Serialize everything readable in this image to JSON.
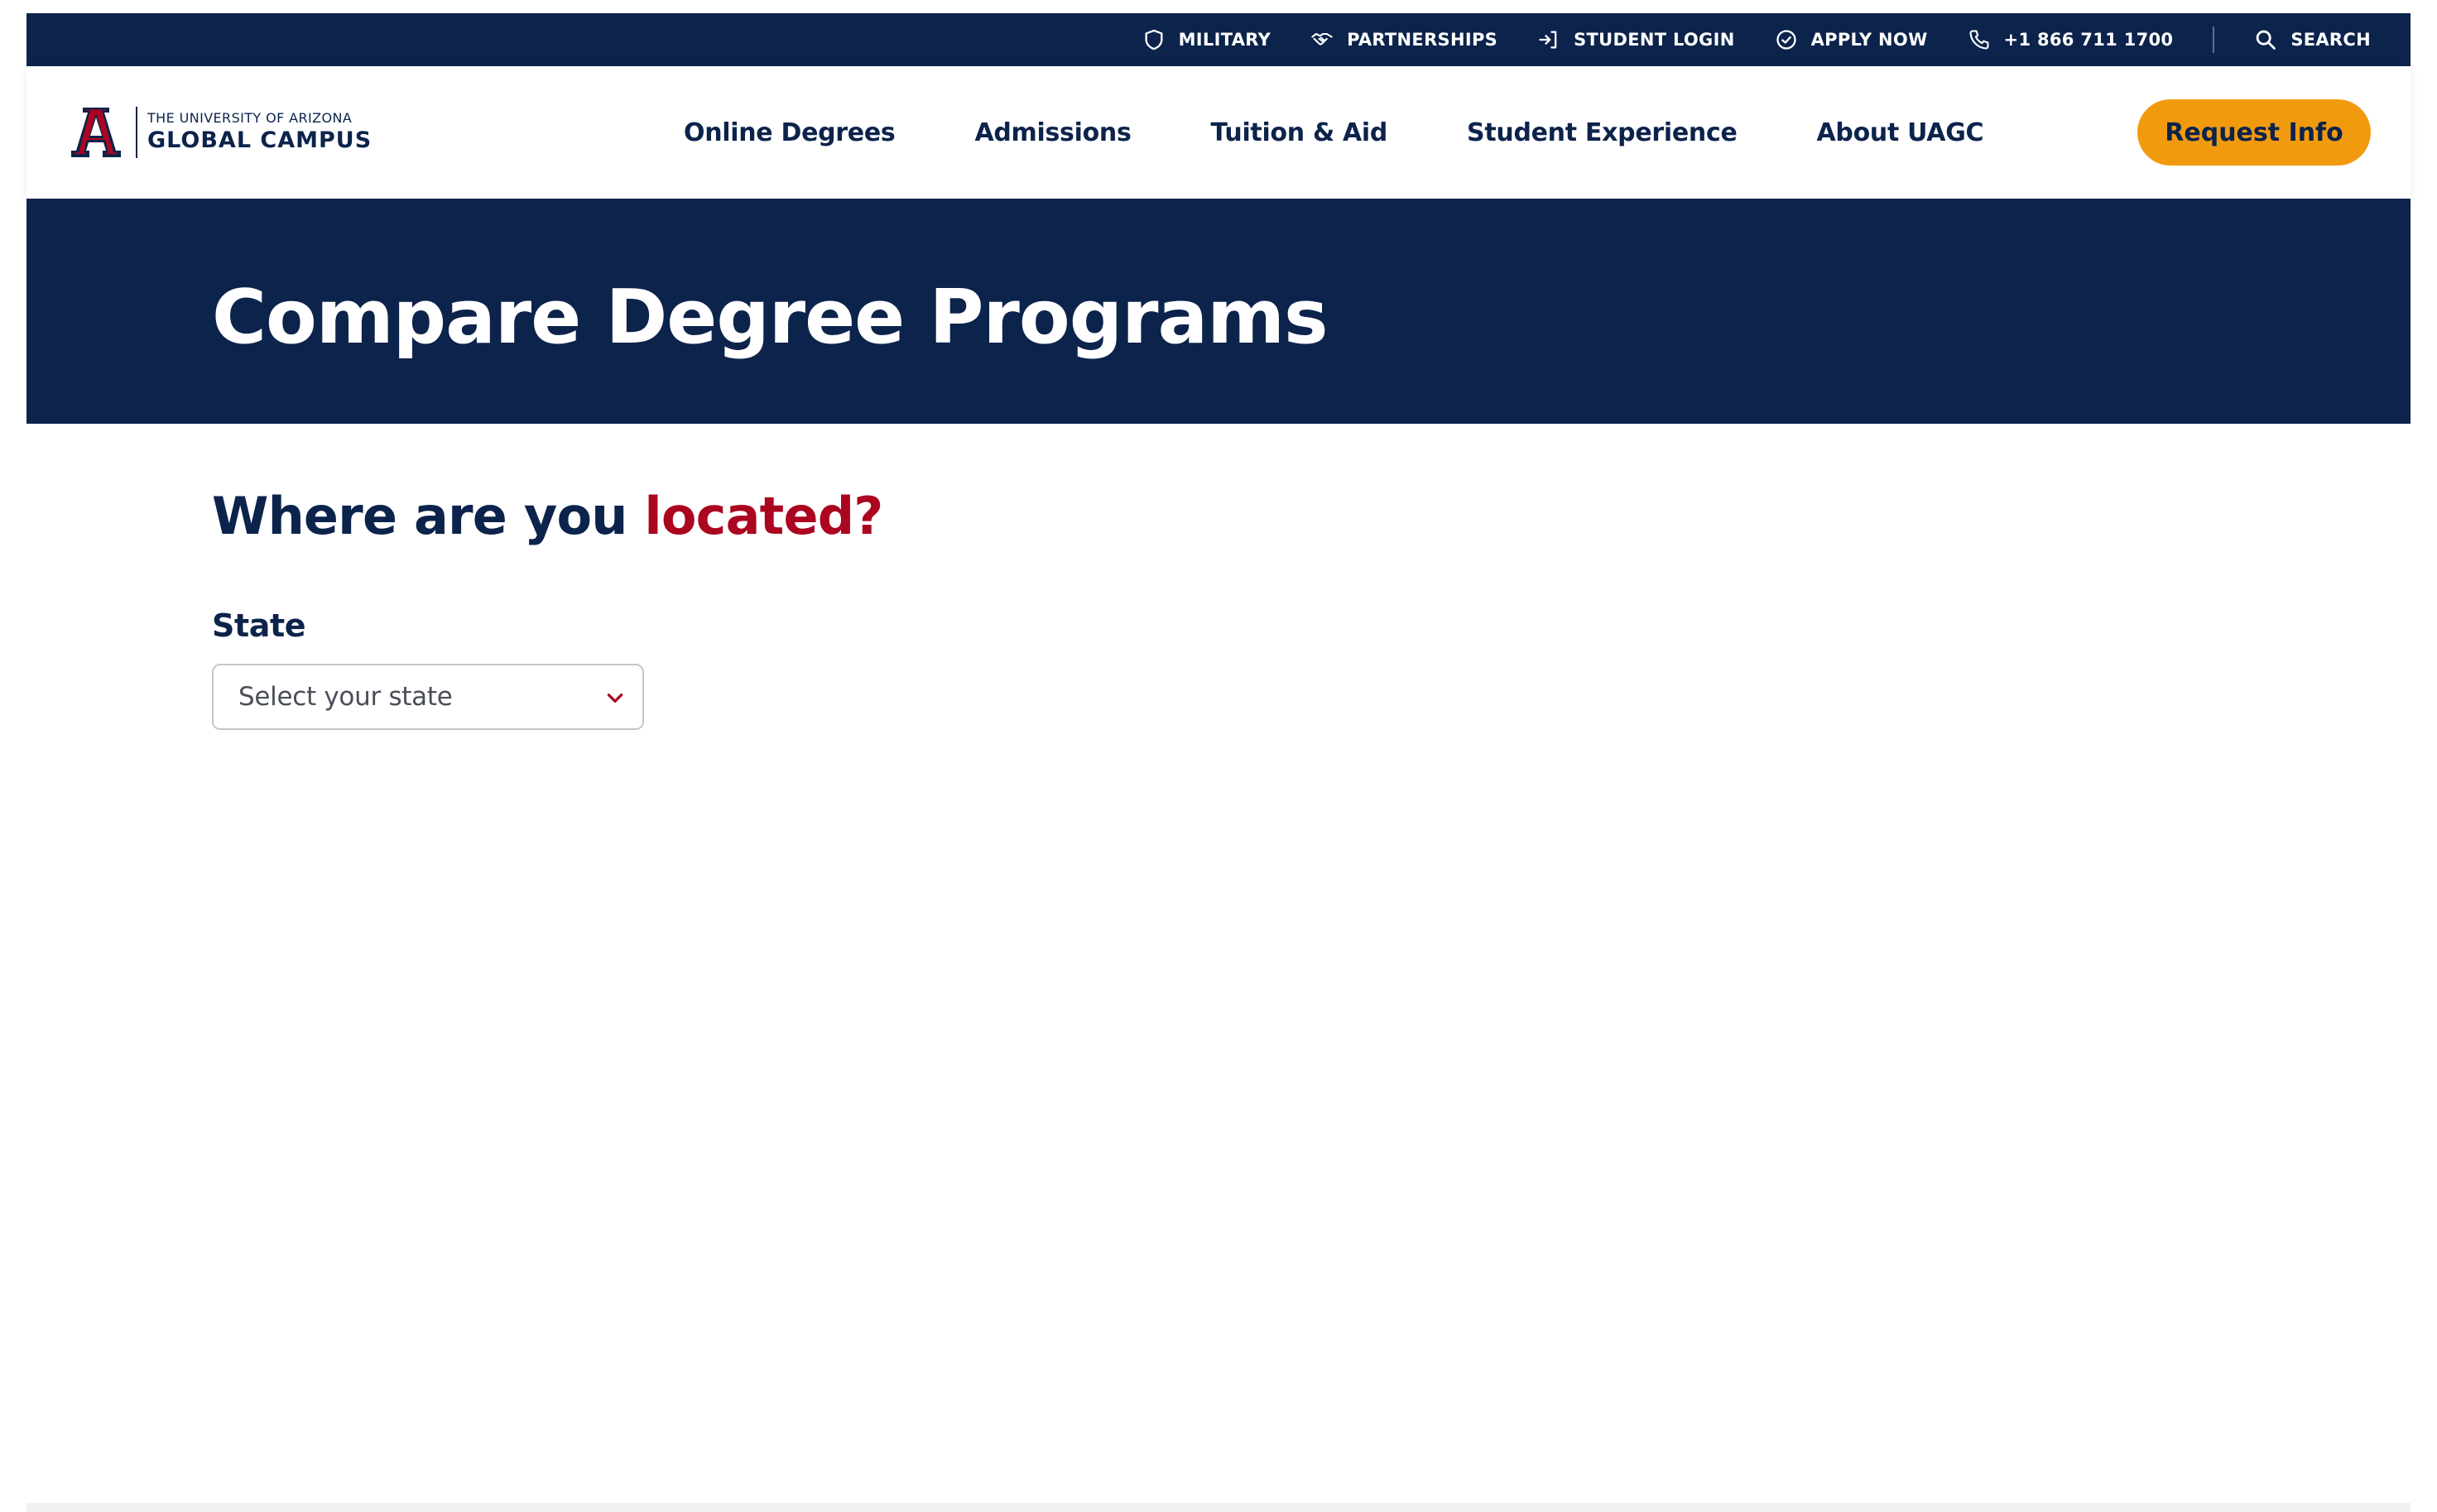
{
  "utility_bar": {
    "items": [
      {
        "label": "MILITARY",
        "icon": "shield-icon"
      },
      {
        "label": "PARTNERSHIPS",
        "icon": "handshake-icon"
      },
      {
        "label": "STUDENT LOGIN",
        "icon": "login-icon"
      },
      {
        "label": "APPLY NOW",
        "icon": "check-circle-icon"
      },
      {
        "label": "+1 866 711 1700",
        "icon": "phone-icon"
      }
    ],
    "search_label": "SEARCH",
    "search_icon": "search-icon"
  },
  "header": {
    "logo": {
      "line1": "THE UNIVERSITY OF ARIZONA",
      "line2": "GLOBAL CAMPUS"
    },
    "nav": [
      "Online Degrees",
      "Admissions",
      "Tuition & Aid",
      "Student Experience",
      "About UAGC"
    ],
    "cta_label": "Request Info"
  },
  "hero": {
    "title": "Compare Degree Programs"
  },
  "location": {
    "heading_main": "Where are you",
    "heading_accent": "located?",
    "state_label": "State",
    "state_select": {
      "value": "Select your state",
      "icon": "chevron-down-icon"
    }
  },
  "colors": {
    "navy": "#0c234b",
    "red": "#ab0520",
    "orange": "#f29a0e"
  }
}
